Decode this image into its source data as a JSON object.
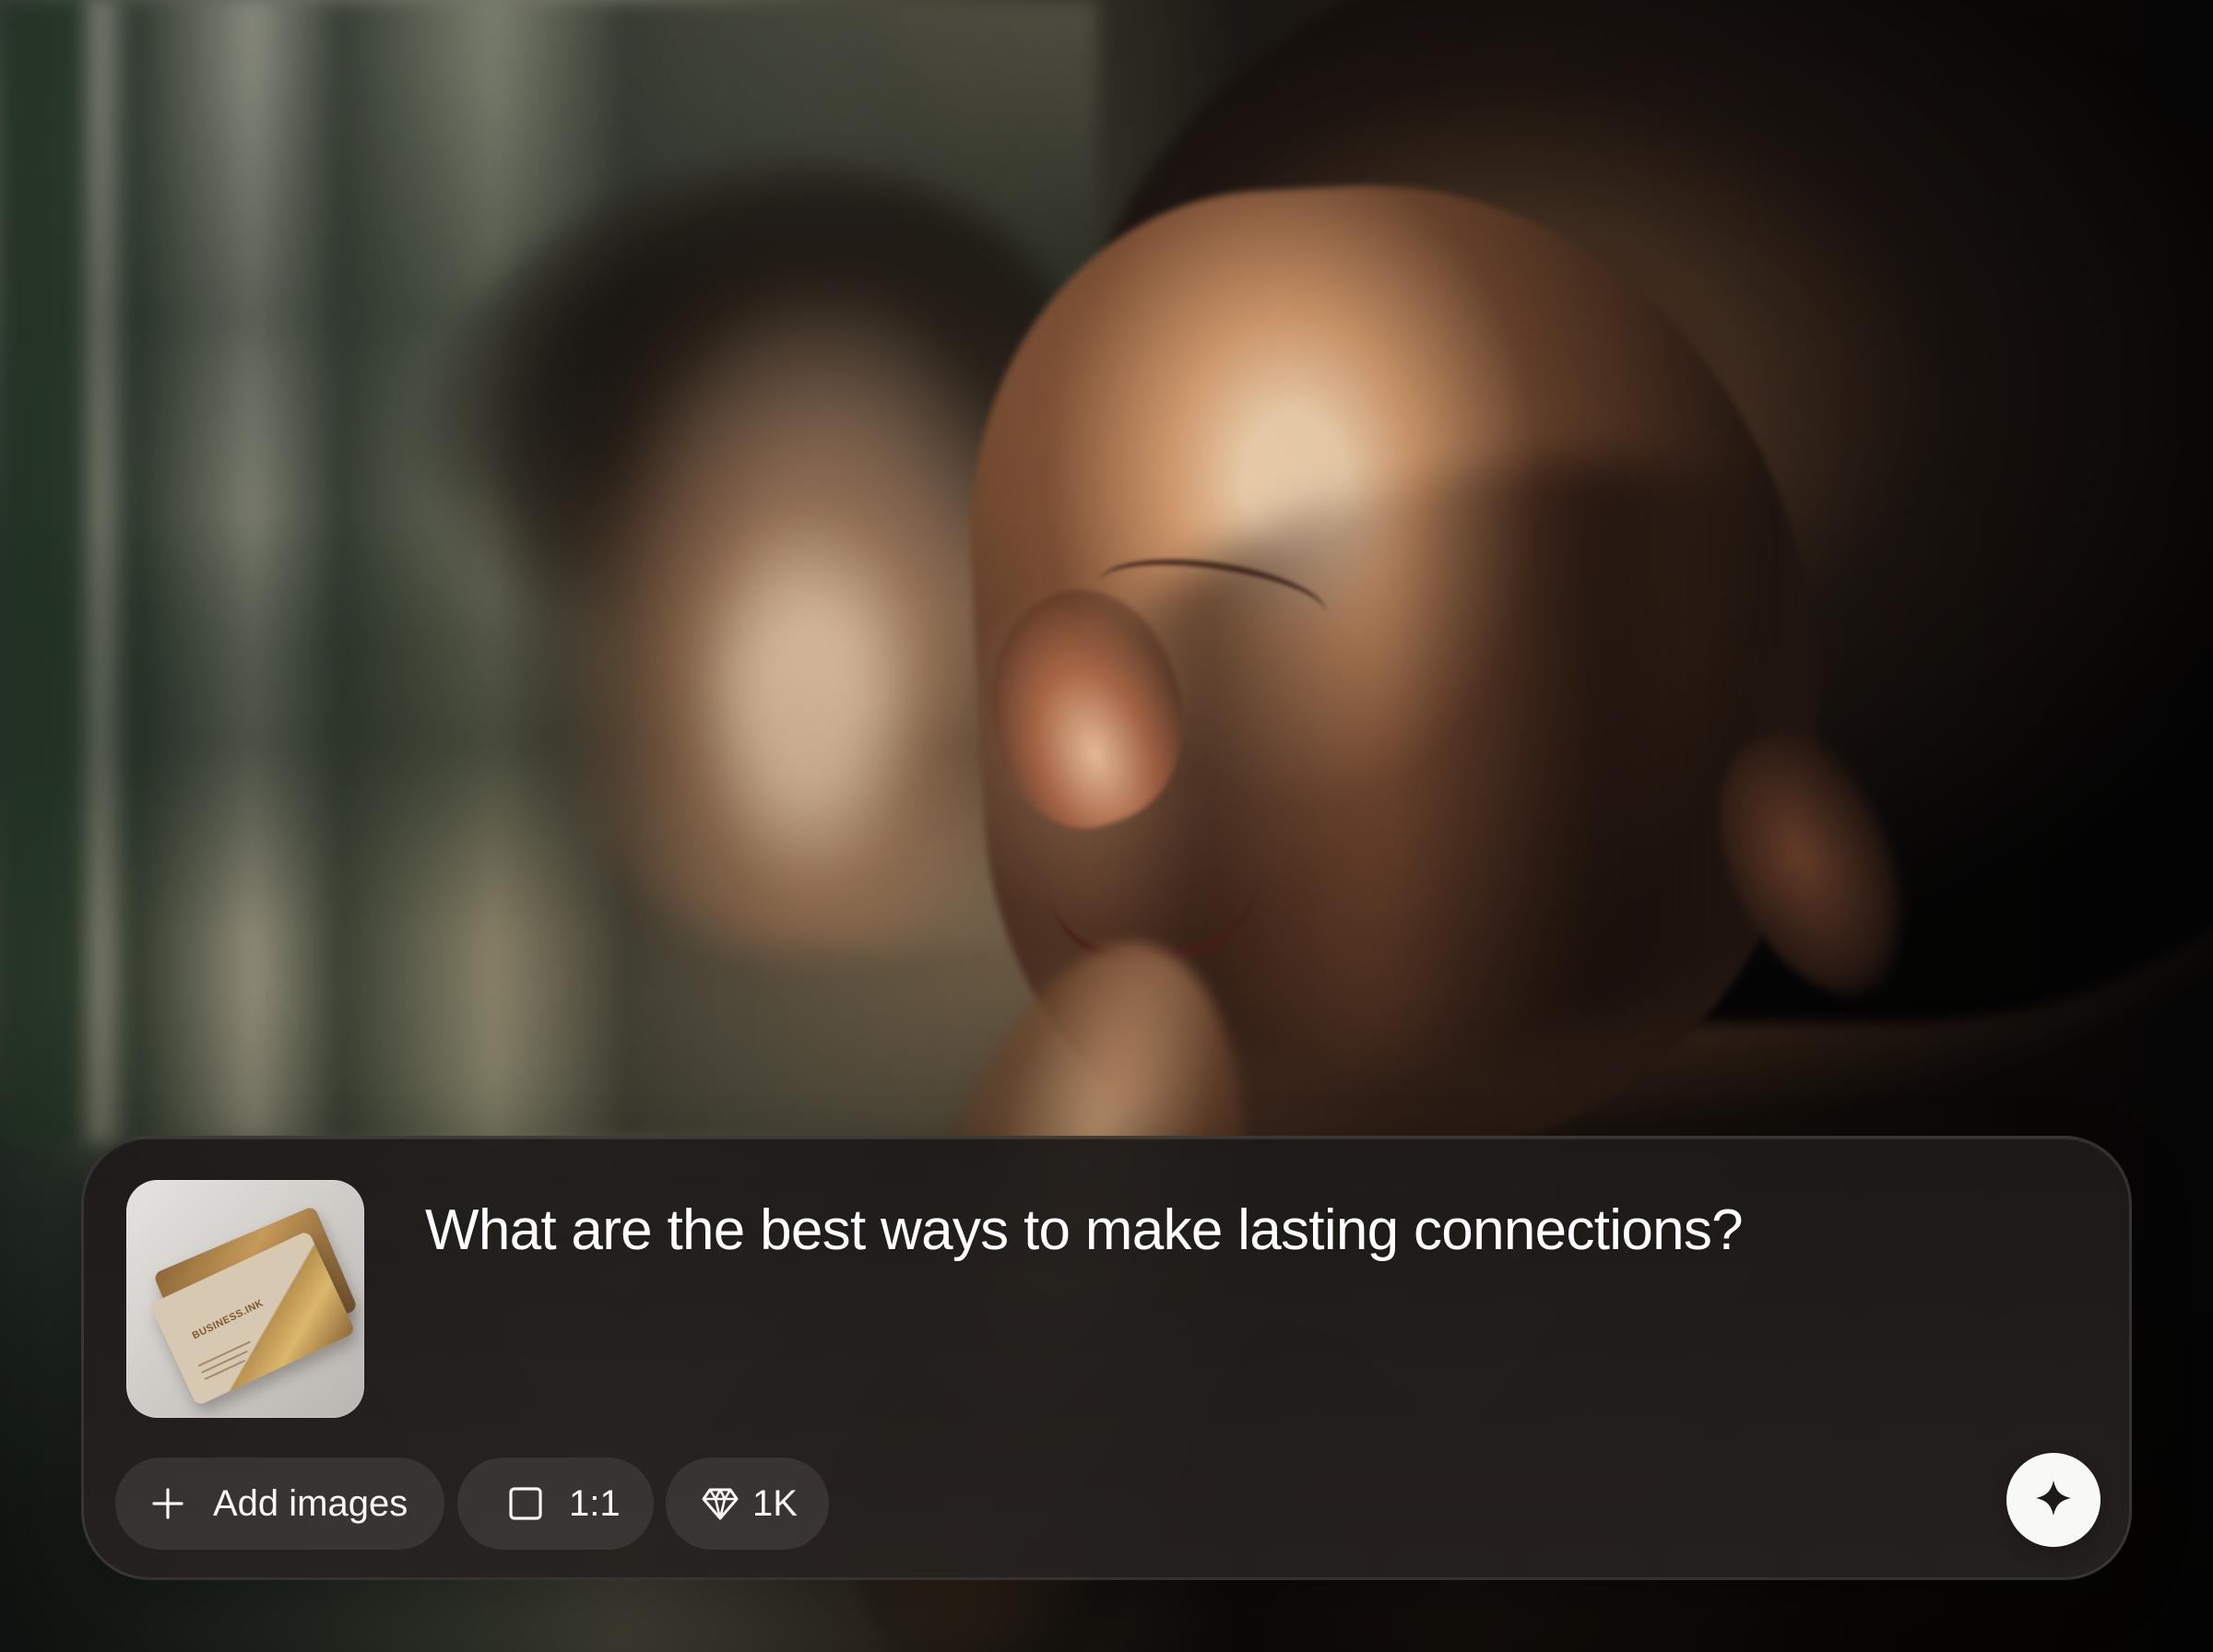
{
  "composer": {
    "prompt": "What are the best ways to make lasting connections?",
    "attachment": {
      "card_logo": "BUSINESS.INK"
    },
    "controls": {
      "add_images_label": "Add images",
      "aspect_ratio_label": "1:1",
      "quality_label": "1K"
    },
    "icons": {
      "add": "plus-icon",
      "aspect_ratio": "square-icon",
      "quality": "diamond-icon",
      "generate": "sparkle-icon"
    }
  },
  "colors": {
    "composer_text": "#ffffff",
    "chip_text": "#f8f8f7",
    "generate_button": "#f8f8f7",
    "generate_icon": "#1b1a19"
  }
}
